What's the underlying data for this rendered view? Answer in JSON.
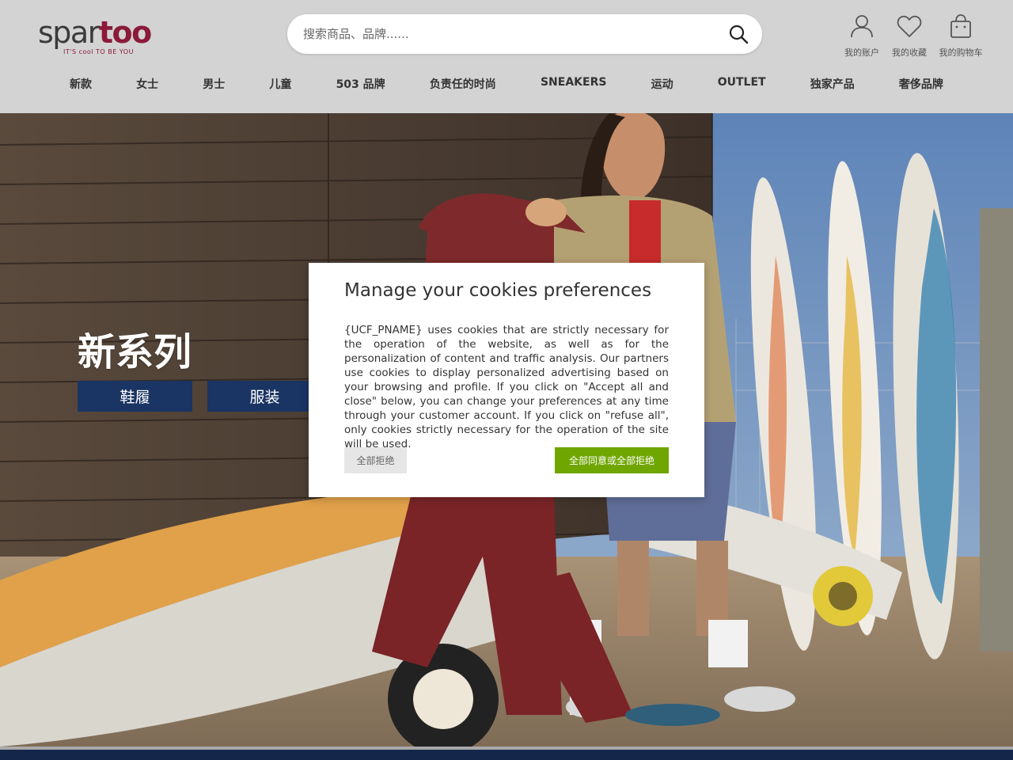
{
  "brand": {
    "logo_part1": "spar",
    "logo_part2": "too",
    "tagline": "IT'S cool TO BE YOU",
    "accent_color": "#8b1a3a"
  },
  "search": {
    "placeholder": "搜索商品、品牌......",
    "icon": "search-icon"
  },
  "user_menu": [
    {
      "label": "我的账户",
      "icon": "user-icon"
    },
    {
      "label": "我的收藏",
      "icon": "heart-icon"
    },
    {
      "label": "我的购物车",
      "icon": "shopping-bag-icon"
    }
  ],
  "nav": [
    {
      "label": "新款"
    },
    {
      "label": "女士"
    },
    {
      "label": "男士"
    },
    {
      "label": "儿童"
    },
    {
      "label": "503 品牌"
    },
    {
      "label": "负责任的时尚"
    },
    {
      "label": "SNEAKERS"
    },
    {
      "label": "运动"
    },
    {
      "label": "OUTLET"
    },
    {
      "label": "独家产品"
    },
    {
      "label": "奢侈品牌"
    }
  ],
  "hero": {
    "title": "新系列",
    "buttons": [
      {
        "label": "鞋履"
      },
      {
        "label": "服装"
      }
    ],
    "button_color": "#1a3463"
  },
  "cookie_dialog": {
    "title": "Manage your cookies preferences",
    "body": "{UCF_PNAME} uses cookies that are strictly necessary for the operation of the website, as well as for the personalization of content and traffic analysis. Our partners use cookies to display personalized advertising based on your browsing and profile. If you click on \"Accept all and close\" below, you can change your preferences at any time through your customer account. If you click on \"refuse all\", only cookies strictly necessary for the operation of the site will be used.",
    "refuse_label": "全部拒绝",
    "accept_label": "全部同意或全部拒绝",
    "accept_color": "#6fa600"
  }
}
